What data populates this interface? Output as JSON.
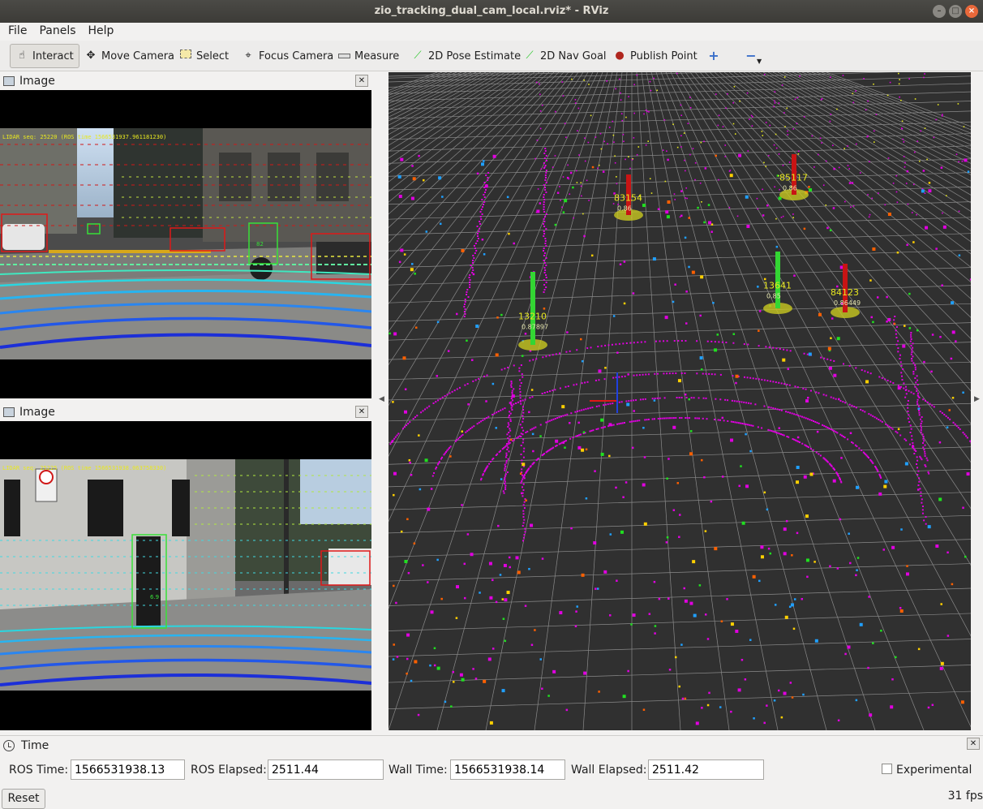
{
  "window": {
    "title": "zio_tracking_dual_cam_local.rviz* - RViz"
  },
  "menu": {
    "file": "File",
    "panels": "Panels",
    "help": "Help"
  },
  "toolbar": {
    "interact": "Interact",
    "move_camera": "Move Camera",
    "select": "Select",
    "focus_camera": "Focus Camera",
    "measure": "Measure",
    "pose_estimate": "2D Pose Estimate",
    "nav_goal": "2D Nav Goal",
    "publish_point": "Publish Point"
  },
  "image_panel_top": {
    "title": "Image",
    "overlay_text": "LIDAR seq: 25220 (ROS time 1566531937.961181230)",
    "box_label": "82"
  },
  "image_panel_bottom": {
    "title": "Image",
    "overlay_text": "LIDAR seq: 25225 (ROS time 1566531938.063758330)",
    "box_label": "6.9"
  },
  "tracks": [
    {
      "id": "13210",
      "conf": "0.87897",
      "color": "#33d633"
    },
    {
      "id": "83154",
      "conf": "0.86",
      "color": "#c81414"
    },
    {
      "id": "85117",
      "conf": "0.86",
      "color": "#c81414"
    },
    {
      "id": "13641",
      "conf": "0.85",
      "color": "#33d633"
    },
    {
      "id": "84123",
      "conf": "0.86449",
      "color": "#c81414"
    }
  ],
  "time_panel": {
    "title": "Time",
    "ros_time_label": "ROS Time:",
    "ros_time": "1566531938.13",
    "ros_elapsed_label": "ROS Elapsed:",
    "ros_elapsed": "2511.44",
    "wall_time_label": "Wall Time:",
    "wall_time": "1566531938.14",
    "wall_elapsed_label": "Wall Elapsed:",
    "wall_elapsed": "2511.42",
    "experimental": "Experimental",
    "reset": "Reset",
    "fps": "31 fps"
  },
  "colors": {
    "grid": "#8a8a8a",
    "points": "#e000e0",
    "view_bg": "#303030"
  }
}
